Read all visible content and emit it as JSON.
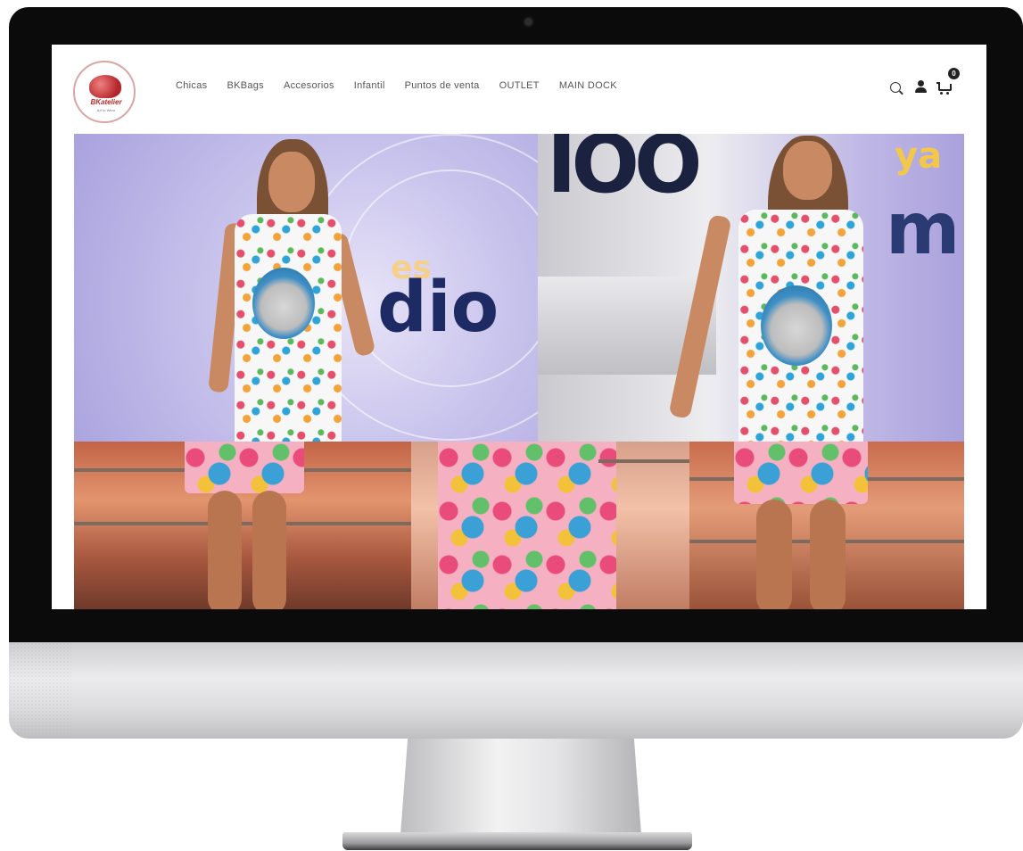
{
  "brand": {
    "logo_name": "BKatelier",
    "logo_tagline": "Art to Wear"
  },
  "nav": {
    "items": [
      "Chicas",
      "BKBags",
      "Accesorios",
      "Infantil",
      "Puntos de venta",
      "OUTLET",
      "MAIN DOCK"
    ]
  },
  "header_icons": {
    "search": "search-icon",
    "account": "user-icon",
    "cart": "cart-icon",
    "cart_count": "0"
  },
  "hero": {
    "photo_texts": {
      "left_small": "es",
      "left_large": "dio",
      "right_top": "IOO",
      "right_side": "ya",
      "right_large": "m"
    }
  },
  "colors": {
    "nav_text": "#555555",
    "brand_red": "#c62828",
    "bezel": "#0b0b0c"
  }
}
